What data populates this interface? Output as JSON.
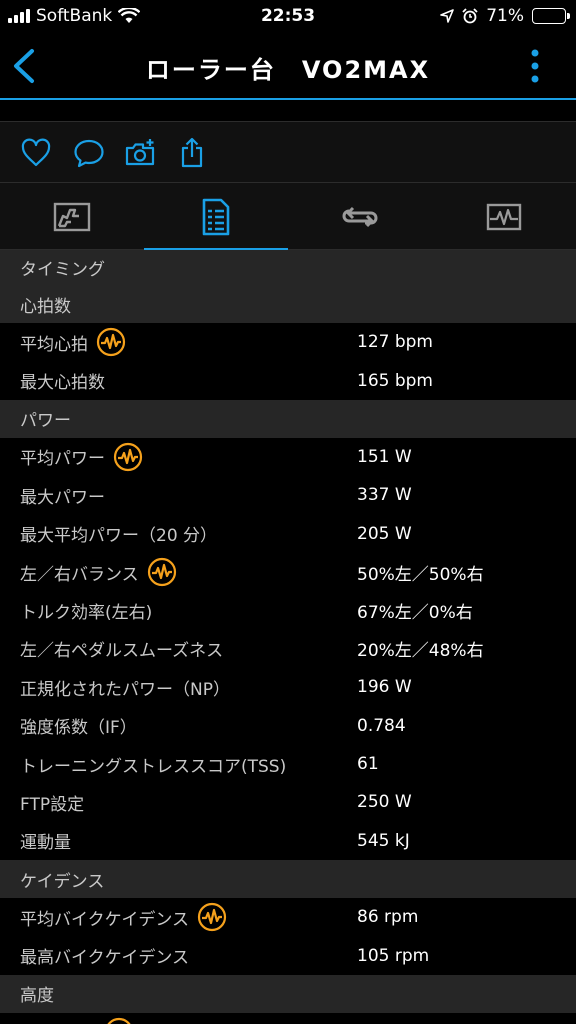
{
  "status": {
    "carrier": "SoftBank",
    "time": "22:53",
    "battery": "71%",
    "battery_level": 0.71
  },
  "nav": {
    "title": "ローラー台　VO2MAX",
    "back_icon": "chevron-left-icon",
    "more_icon": "vertical-dots-icon"
  },
  "actions": [
    {
      "icon": "heart-icon"
    },
    {
      "icon": "comment-icon"
    },
    {
      "icon": "camera-add-icon"
    },
    {
      "icon": "share-icon"
    }
  ],
  "tabs": [
    {
      "icon": "chart-icon"
    },
    {
      "icon": "stats-list-icon",
      "active": true
    },
    {
      "icon": "laps-icon"
    },
    {
      "icon": "graph-icon"
    }
  ],
  "accent_color": "#1aa0e6",
  "badge_color": "#f5a11c",
  "sections": {
    "timing": "タイミング",
    "heart_rate": "心拍数",
    "power": "パワー",
    "cadence": "ケイデンス",
    "elevation": "高度"
  },
  "heart_rate": {
    "avg_label": "平均心拍",
    "avg_value": "127 bpm",
    "max_label": "最大心拍数",
    "max_value": "165 bpm"
  },
  "power": {
    "avg_label": "平均パワー",
    "avg_value": "151 W",
    "max_label": "最大パワー",
    "max_value": "337 W",
    "max_avg_label": "最大平均パワー（20 分）",
    "max_avg_value": "205 W",
    "balance_label": "左／右バランス",
    "balance_value": "50%左／50%右",
    "torque_label": "トルク効率(左右)",
    "torque_value": "67%左／0%右",
    "smooth_label": "左／右ペダルスムーズネス",
    "smooth_value": "20%左／48%右",
    "np_label": "正規化されたパワー（NP）",
    "np_value": "196 W",
    "if_label": "強度係数（IF）",
    "if_value": "0.784",
    "tss_label": "トレーニングストレススコア(TSS)",
    "tss_value": "61",
    "ftp_label": "FTP設定",
    "ftp_value": "250 W",
    "work_label": "運動量",
    "work_value": "545 kJ"
  },
  "cadence": {
    "avg_label": "平均バイクケイデンス",
    "avg_value": "86 rpm",
    "max_label": "最高バイクケイデンス",
    "max_value": "105 rpm"
  }
}
